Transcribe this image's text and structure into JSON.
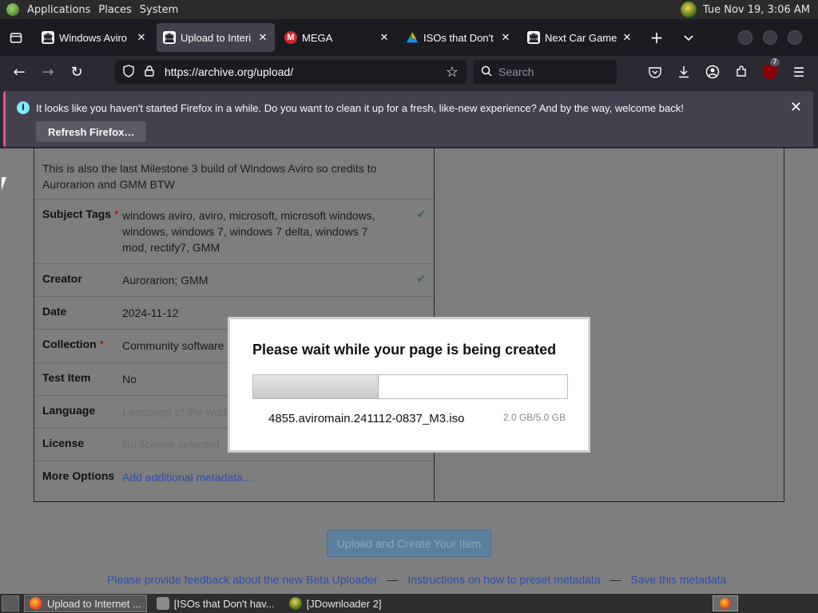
{
  "system_bar": {
    "menus": [
      "Applications",
      "Places",
      "System"
    ],
    "clock": "Tue Nov 19,  3:06 AM"
  },
  "tabs": [
    {
      "title": "Windows Aviro",
      "favicon": "archive-icon",
      "active": false
    },
    {
      "title": "Upload to Interi",
      "favicon": "archive-icon",
      "active": true
    },
    {
      "title": "MEGA",
      "favicon": "mega-icon",
      "active": false
    },
    {
      "title": "ISOs that Don't",
      "favicon": "drive-icon",
      "active": false
    },
    {
      "title": "Next Car Game",
      "favicon": "archive-icon",
      "active": false
    }
  ],
  "mega_letter": "M",
  "navbar": {
    "url": "https://archive.org/upload/",
    "search_placeholder": "Search",
    "ublock_count": "7"
  },
  "notification": {
    "message": "It looks like you haven't started Firefox in a while. Do you want to clean it up for a fresh, like-new experience? And by the way, welcome back!",
    "button": "Refresh Firefox…"
  },
  "metadata": {
    "description_tail": "This is also the last Milestone 3 build of Windows Aviro so credits to Aurorarion and GMM BTW",
    "rows": [
      {
        "label": "Subject Tags",
        "required": true,
        "value": "windows aviro, aviro, microsoft, microsoft windows, windows, windows 7, windows 7 delta, windows 7 mod, rectify7, GMM",
        "checked": true
      },
      {
        "label": "Creator",
        "required": false,
        "value": "Aurorarion; GMM",
        "checked": true
      },
      {
        "label": "Date",
        "required": false,
        "value": "2024-11-12",
        "checked": false
      },
      {
        "label": "Collection",
        "required": true,
        "value": "Community software",
        "checked": false
      },
      {
        "label": "Test Item",
        "required": false,
        "value": "No",
        "checked": false
      },
      {
        "label": "Language",
        "required": false,
        "value": "Language of the work",
        "placeholder": true,
        "checked": false
      },
      {
        "label": "License",
        "required": false,
        "value": "No license selected",
        "placeholder": true,
        "checked": false
      },
      {
        "label": "More Options",
        "required": false,
        "value": "Add additional metadata...",
        "link": true,
        "checked": false
      }
    ]
  },
  "upload_button": "Upload and Create Your Item",
  "footer_links": [
    "Please provide feedback about the new Beta Uploader",
    "Instructions on how to preset metadata",
    "Save this metadata"
  ],
  "footer_separator": "—",
  "modal": {
    "title": "Please wait while your page is being created",
    "progress_fraction": 0.4,
    "file_name": "4855.aviromain.241112-0837_M3.iso",
    "file_size": "2.0 GB/5.0 GB"
  },
  "taskbar": [
    {
      "title": "Upload to Internet ...",
      "active": true
    },
    {
      "title": "[ISOs that Don't hav...",
      "active": false
    },
    {
      "title": "[JDownloader 2]",
      "active": false
    }
  ],
  "colors": {
    "firefox_dark": "#1c1b22",
    "notification_accent": "#e75289",
    "page_dimmed": "#7e7e7e",
    "link": "#2f4fa8"
  }
}
